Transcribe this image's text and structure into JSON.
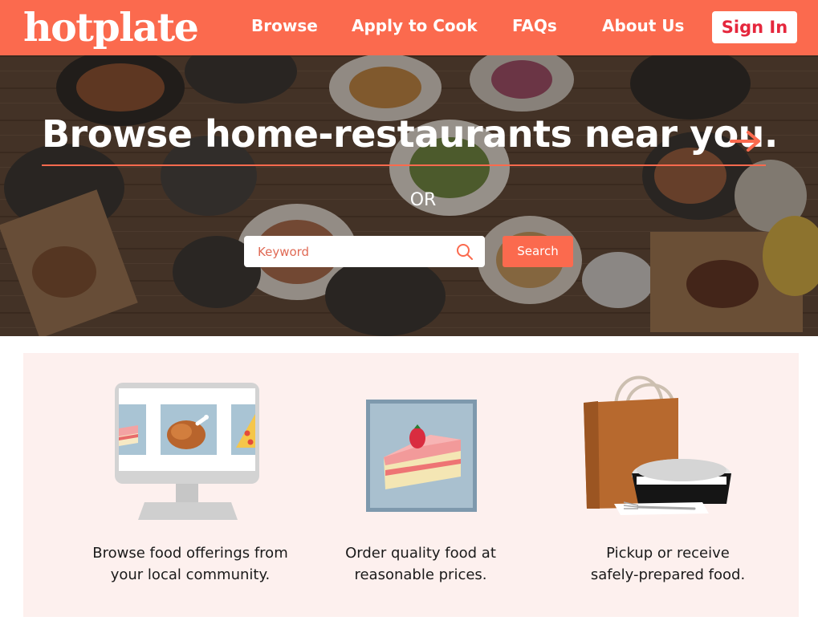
{
  "header": {
    "logo_text": "hotplate",
    "nav": {
      "browse": "Browse",
      "apply": "Apply to Cook",
      "faqs": "FAQs",
      "about": "About Us"
    },
    "sign_in": "Sign In"
  },
  "hero": {
    "title": "Browse home-restaurants near you.",
    "arrow_icon": "arrow-right-icon",
    "or_text": "OR",
    "search": {
      "placeholder": "Keyword",
      "value": "",
      "button_label": "Search"
    }
  },
  "features": [
    {
      "line1": "Browse food offerings from",
      "line2": "your local community.",
      "icon": "monitor-food-icon"
    },
    {
      "line1": "Order quality food at",
      "line2": "reasonable prices.",
      "icon": "cake-slice-icon"
    },
    {
      "line1": "Pickup or receive",
      "line2": "safely-prepared food.",
      "icon": "takeout-bag-icon"
    }
  ],
  "colors": {
    "brand": "#fb6a4e",
    "signin_text": "#e5273d",
    "panel_bg": "#fdf0ee"
  }
}
